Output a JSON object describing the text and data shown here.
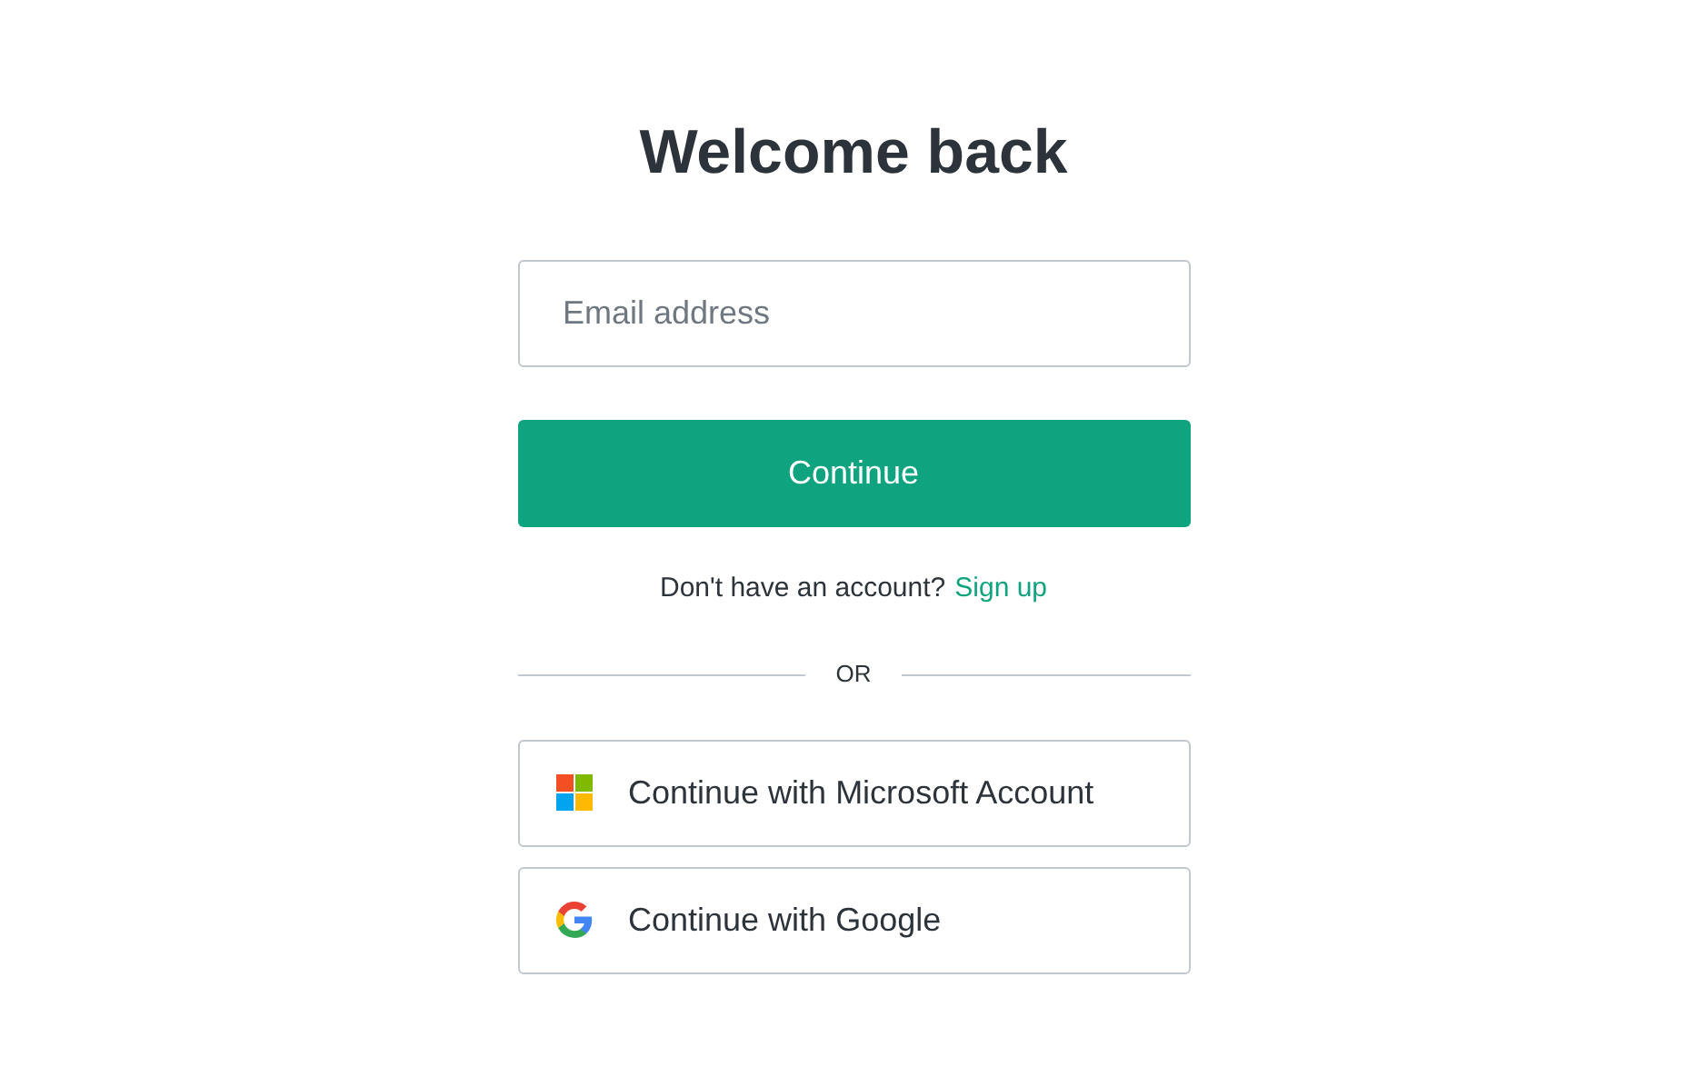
{
  "title": "Welcome back",
  "email_field": {
    "placeholder": "Email address"
  },
  "continue_button": "Continue",
  "signup_prompt": {
    "text": "Don't have an account?",
    "link": "Sign up"
  },
  "divider": "OR",
  "providers": [
    {
      "kind": "microsoft",
      "label": "Continue with Microsoft Account"
    },
    {
      "kind": "google",
      "label": "Continue with Google"
    }
  ]
}
